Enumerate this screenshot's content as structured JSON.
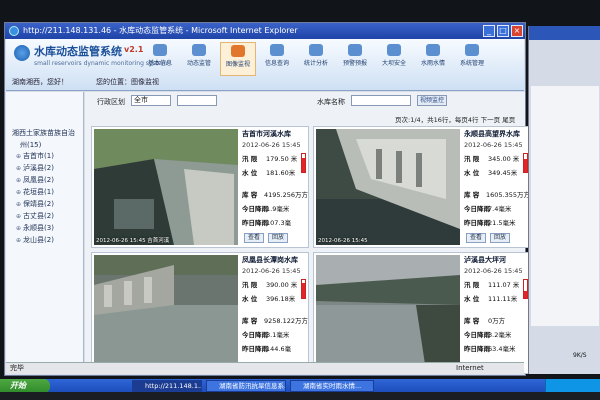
{
  "window": {
    "title": "http://211.148.131.46 - 水库动态监管系统 - Microsoft Internet Explorer"
  },
  "app": {
    "title": "水库动态监管系统",
    "version": "v2.1",
    "subtitle": "small reservoirs dynamic monitoring system",
    "user_label": "湖南湘西，您好！",
    "breadcrumb": "您的位置：图像监视"
  },
  "nav": [
    {
      "label": "基本信息",
      "icon": "info-icon"
    },
    {
      "label": "动态监管",
      "icon": "monitor-icon"
    },
    {
      "label": "图像监视",
      "icon": "camera-icon",
      "active": true
    },
    {
      "label": "信息查询",
      "icon": "query-icon"
    },
    {
      "label": "统计分析",
      "icon": "chart-icon"
    },
    {
      "label": "预警预报",
      "icon": "alert-icon"
    },
    {
      "label": "大坝安全",
      "icon": "dam-icon"
    },
    {
      "label": "水雨水情",
      "icon": "rain-icon"
    },
    {
      "label": "系统管理",
      "icon": "settings-icon"
    }
  ],
  "sidebar": {
    "root": "湘西土家族苗族自治",
    "count": "州(15)",
    "items": [
      "吉首市(1)",
      "泸溪县(2)",
      "凤凰县(2)",
      "花垣县(1)",
      "保靖县(2)",
      "古丈县(2)",
      "永顺县(3)",
      "龙山县(2)"
    ]
  },
  "filter": {
    "region_label": "行政区划",
    "region_value": "全市",
    "region_sub_value": "",
    "name_label": "水库名称",
    "video_button": "视频监控"
  },
  "pager": "页次:1/4，共16行，每页4行  下一页 尾页",
  "card_labels": {
    "flood_limit": "汛 限",
    "water_level": "水 位",
    "capacity": "库 容",
    "rain_today": "今日降雨",
    "rain_yesterday": "昨日降雨",
    "view_button": "查看",
    "playback_button": "回放"
  },
  "cards": [
    {
      "name": "吉首市河溪水库",
      "time": "2012-06-26 15:45",
      "flood_limit": "179.50 米",
      "water_level": "181.60米",
      "capacity": "4195.256万方",
      "rain_today": "1.9毫米",
      "rain_yesterday": "107.3毫",
      "caption": "2012-06-26 15:45 吉首河溪",
      "level": 0.8
    },
    {
      "name": "永顺县高望界水库",
      "time": "2012-06-26 15:45",
      "flood_limit": "345.00 米",
      "water_level": "349.45米",
      "capacity": "1605.355万方",
      "rain_today": "7.4毫米",
      "rain_yesterday": "21.5毫米",
      "caption": "2012-06-26 15:45",
      "level": 0.75
    },
    {
      "name": "凤凰县长潭岗水库",
      "time": "2012-06-26 15:45",
      "flood_limit": "390.00 米",
      "water_level": "396.18米",
      "capacity": "9258.122万方",
      "rain_today": "3.1毫米",
      "rain_yesterday": "144.6毫",
      "caption": "",
      "level": 0.85
    },
    {
      "name": "泸溪县大坪河",
      "time": "2012-06-26 15:45",
      "flood_limit": "111.07 米",
      "water_level": "111.11米",
      "capacity": "0万方",
      "rain_today": "3.2毫米",
      "rain_yesterday": "63.4毫米",
      "caption": "",
      "level": 0.4
    }
  ],
  "statusbar": {
    "left": "完毕",
    "right": "Internet"
  },
  "taskbar": {
    "start": "开始",
    "tasks": [
      "http://211.148.1...",
      "湖南省防汛抗旱信息系...",
      "湖南省实时雨水情..."
    ]
  },
  "background_window": {
    "text": "9K/S"
  }
}
